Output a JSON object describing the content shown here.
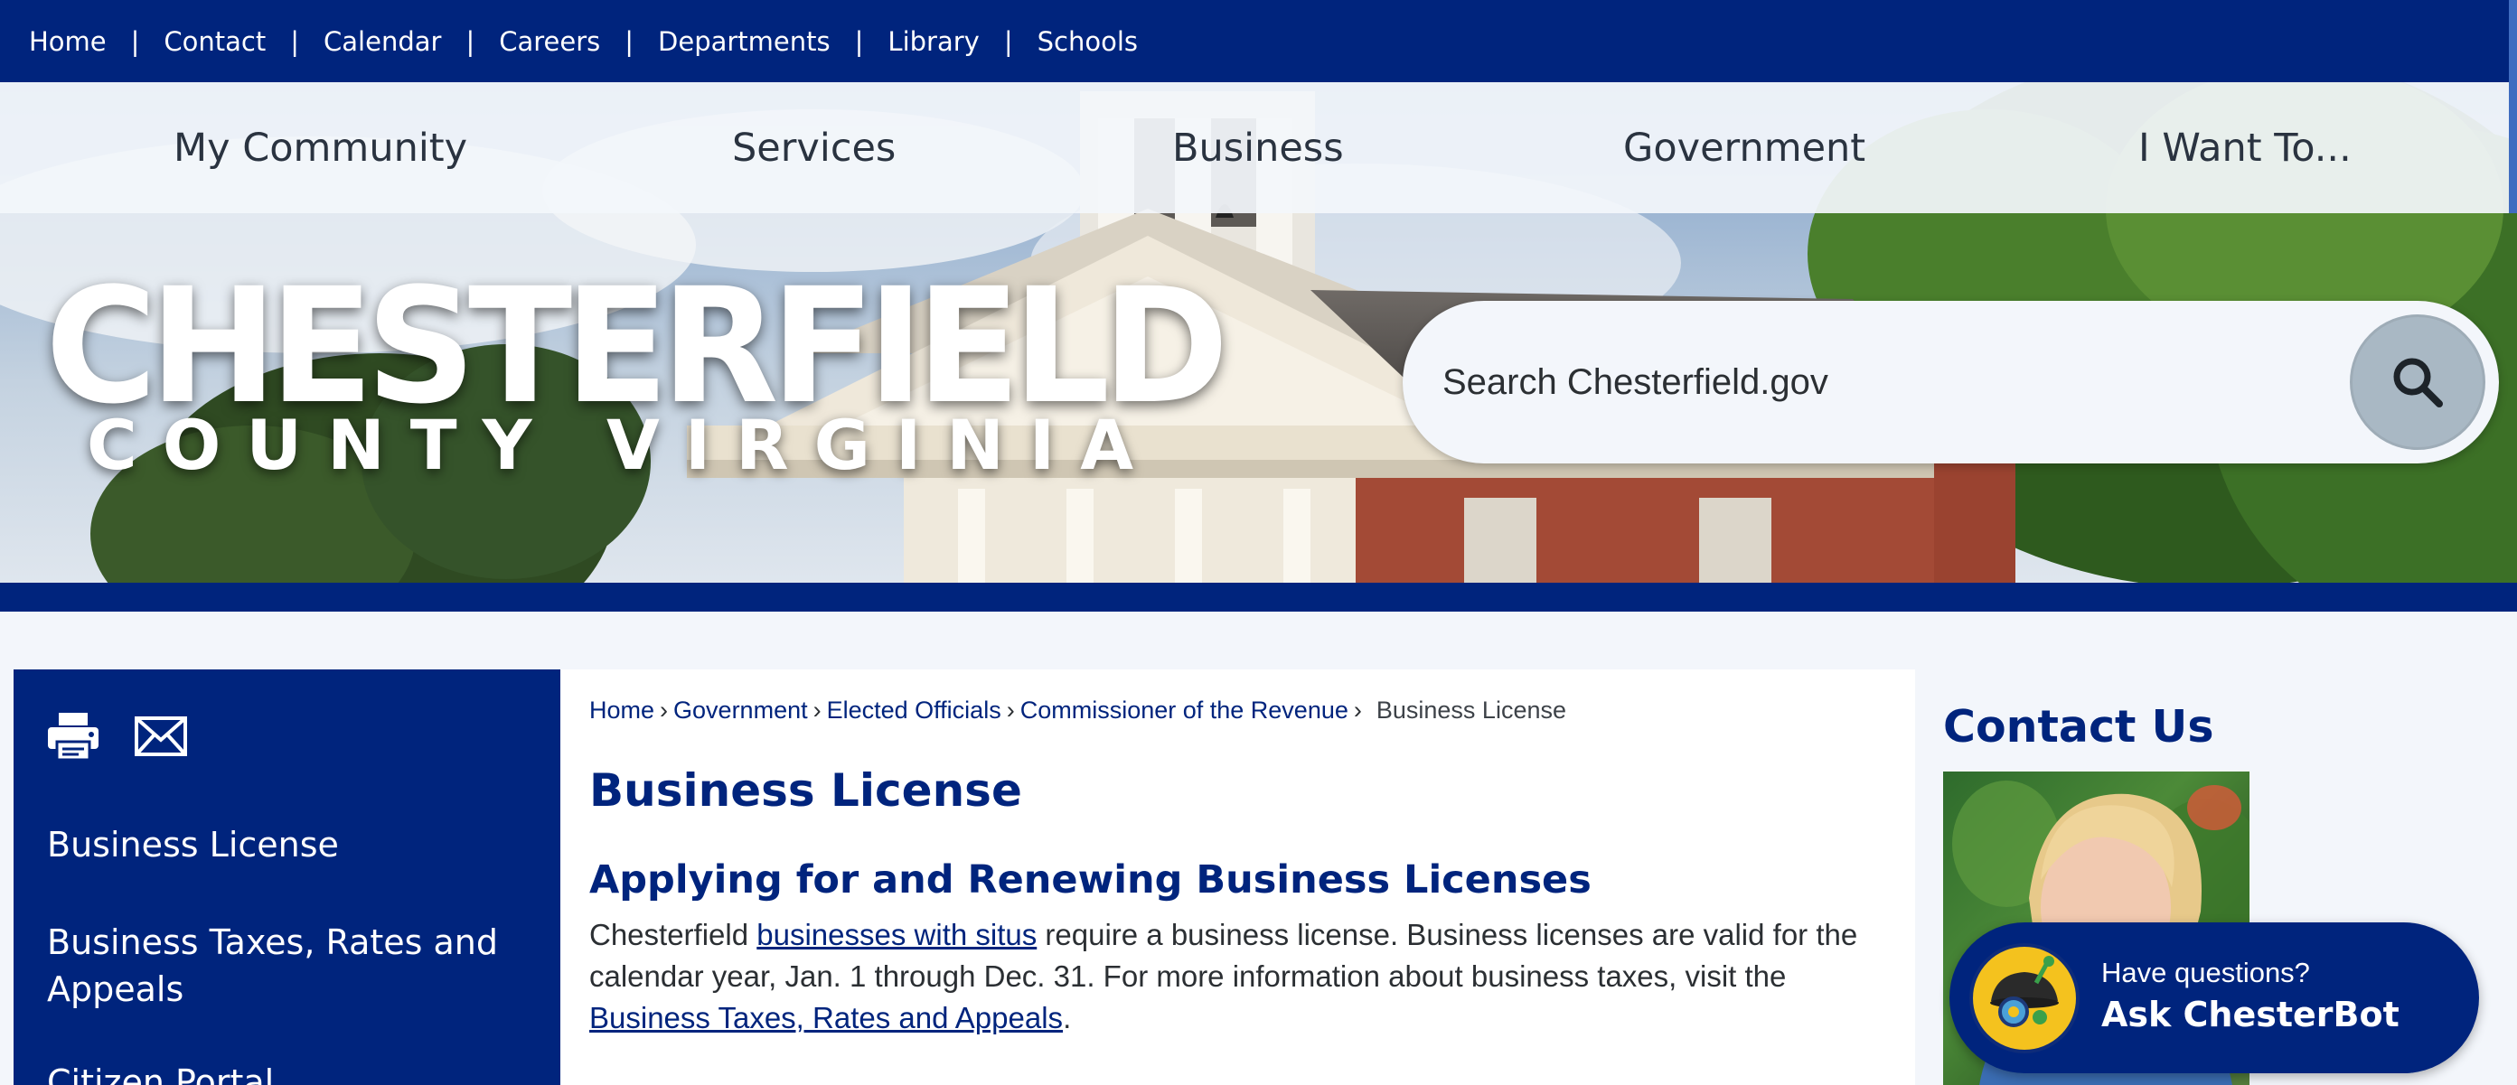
{
  "utility_nav": {
    "items": [
      "Home",
      "Contact",
      "Calendar",
      "Careers",
      "Departments",
      "Library",
      "Schools"
    ]
  },
  "main_nav": {
    "items": [
      "My Community",
      "Services",
      "Business",
      "Government",
      "I Want To..."
    ]
  },
  "logo": {
    "title": "CHESTERFIELD",
    "subtitle": "COUNTY VIRGINIA"
  },
  "search": {
    "placeholder": "Search Chesterfield.gov",
    "icon": "magnifier-icon"
  },
  "sidebar": {
    "tools": [
      "printer-icon",
      "envelope-icon"
    ],
    "items": [
      "Business License",
      "Business Taxes, Rates and Appeals",
      "Citizen Portal"
    ]
  },
  "breadcrumb": {
    "items": [
      "Home",
      "Government",
      "Elected Officials",
      "Commissioner of the Revenue"
    ],
    "separator": "›",
    "current": "Business License"
  },
  "content": {
    "title": "Business License",
    "subheading": "Applying for and Renewing Business Licenses",
    "para_prefix": "Chesterfield ",
    "link1": "businesses with situs",
    "para_mid": " require a business license. Business licenses are valid for the calendar year, Jan. 1 through Dec. 31. For more information about business taxes, visit the ",
    "link2": "Business Taxes, Rates and Appeals",
    "para_suffix": "."
  },
  "rail": {
    "contact_title": "Contact Us"
  },
  "chatbot": {
    "question": "Have questions?",
    "cta": "Ask ChesterBot",
    "icon": "chesterbot-icon"
  },
  "colors": {
    "primary_navy": "#00247d",
    "nav_background": "#f3f6fb",
    "body_text": "#2b2f33",
    "search_button": "#a9b8c4",
    "chatbot_accent": "#f4c21e"
  }
}
